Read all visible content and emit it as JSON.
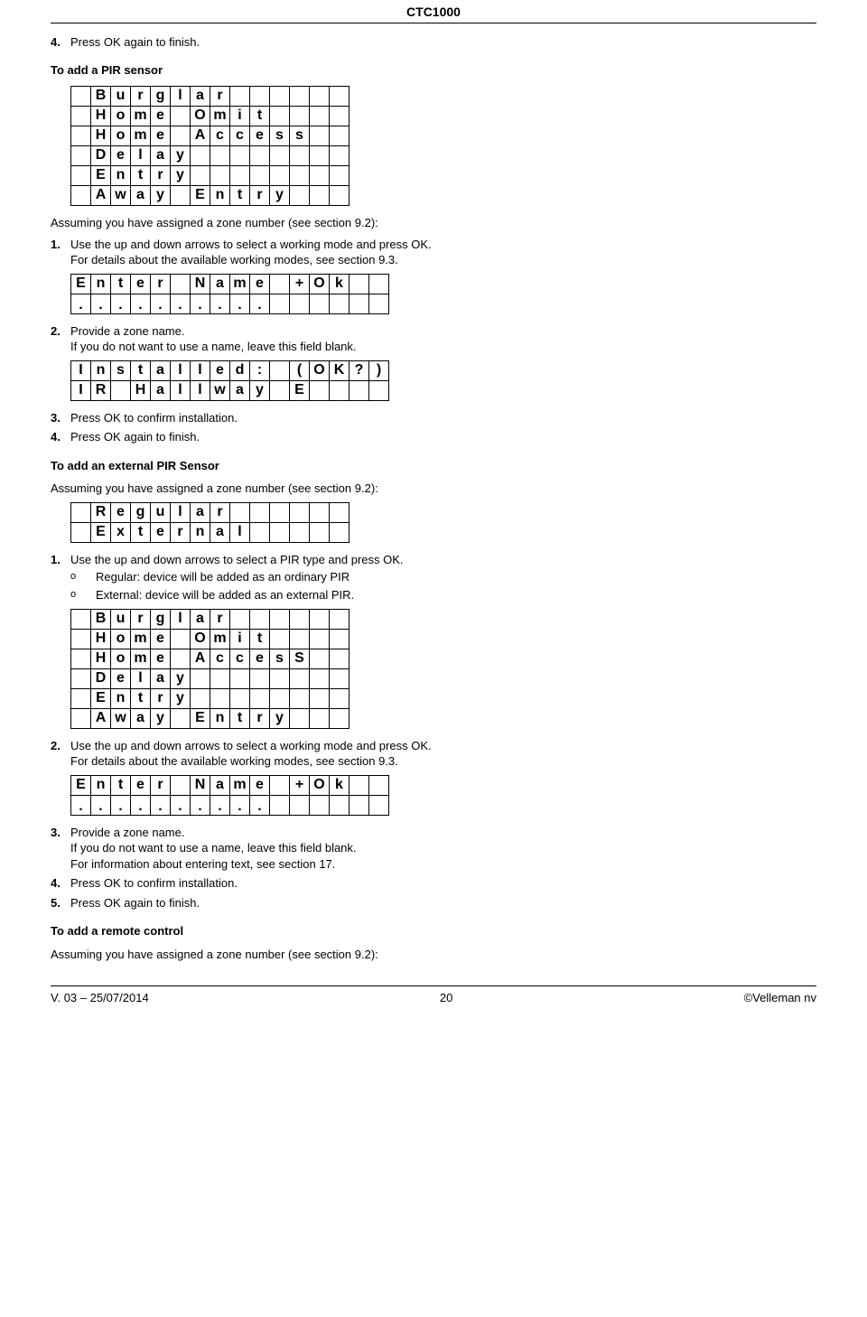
{
  "header": {
    "title": "CTC1000"
  },
  "step4_top": {
    "num": "4.",
    "text": "Press OK again to finish."
  },
  "sec_pir": {
    "heading": "To add a PIR sensor"
  },
  "lcd_pir_modes": [
    [
      "",
      "B",
      "u",
      "r",
      "g",
      "l",
      "a",
      "r",
      "",
      "",
      "",
      "",
      "",
      ""
    ],
    [
      "",
      "H",
      "o",
      "m",
      "e",
      "",
      "O",
      "m",
      "i",
      "t",
      "",
      "",
      "",
      ""
    ],
    [
      "",
      "H",
      "o",
      "m",
      "e",
      "",
      "A",
      "c",
      "c",
      "e",
      "s",
      "s",
      "",
      ""
    ],
    [
      "",
      "D",
      "e",
      "l",
      "a",
      "y",
      "",
      "",
      "",
      "",
      "",
      "",
      "",
      ""
    ],
    [
      "",
      "E",
      "n",
      "t",
      "r",
      "y",
      "",
      "",
      "",
      "",
      "",
      "",
      "",
      ""
    ],
    [
      "",
      "A",
      "w",
      "a",
      "y",
      "",
      "E",
      "n",
      "t",
      "r",
      "y",
      "",
      "",
      ""
    ]
  ],
  "pir_assume": "Assuming you have assigned a zone number (see section 9.2):",
  "pir_s1": {
    "num": "1.",
    "text": "Use the up and down arrows to select a working mode and press OK.",
    "extra": "For details about the available working modes, see section 9.3."
  },
  "lcd_enter_name": [
    [
      "E",
      "n",
      "t",
      "e",
      "r",
      "",
      "N",
      "a",
      "m",
      "e",
      "",
      "+",
      "O",
      "k",
      "",
      ""
    ],
    [
      ".",
      ".",
      ".",
      ".",
      ".",
      ".",
      ".",
      ".",
      ".",
      ".",
      "",
      "",
      "",
      "",
      "",
      ""
    ]
  ],
  "pir_s2": {
    "num": "2.",
    "text": "Provide a zone name.",
    "extra": "If you do not want to use a name, leave this field blank."
  },
  "lcd_installed": [
    [
      "I",
      "n",
      "s",
      "t",
      "a",
      "l",
      "l",
      "e",
      "d",
      ":",
      "",
      "(",
      "O",
      "K",
      "?",
      ")"
    ],
    [
      "I",
      "R",
      "",
      "H",
      "a",
      "l",
      "l",
      "w",
      "a",
      "y",
      "",
      "E",
      "",
      "",
      "",
      ""
    ]
  ],
  "pir_s3": {
    "num": "3.",
    "text": "Press OK to confirm installation."
  },
  "pir_s4": {
    "num": "4.",
    "text": "Press OK again to finish."
  },
  "sec_ext": {
    "heading": "To add an external PIR Sensor",
    "assume": "Assuming you have assigned a zone number (see section 9.2):"
  },
  "lcd_ext_type": [
    [
      "",
      "R",
      "e",
      "g",
      "u",
      "l",
      "a",
      "r",
      "",
      "",
      "",
      "",
      "",
      ""
    ],
    [
      "",
      "E",
      "x",
      "t",
      "e",
      "r",
      "n",
      "a",
      "l",
      "",
      "",
      "",
      "",
      ""
    ]
  ],
  "ext_s1": {
    "num": "1.",
    "text": "Use the up and down arrows to select a PIR type and press OK.",
    "sub1": "Regular: device will be added as an ordinary PIR",
    "sub2": "External: device will be added as an external PIR."
  },
  "lcd_ext_modes": [
    [
      "",
      "B",
      "u",
      "r",
      "g",
      "l",
      "a",
      "r",
      "",
      "",
      "",
      "",
      "",
      ""
    ],
    [
      "",
      "H",
      "o",
      "m",
      "e",
      "",
      "O",
      "m",
      "i",
      "t",
      "",
      "",
      "",
      ""
    ],
    [
      "",
      "H",
      "o",
      "m",
      "e",
      "",
      "A",
      "c",
      "c",
      "e",
      "s",
      "S",
      "",
      ""
    ],
    [
      "",
      "D",
      "e",
      "l",
      "a",
      "y",
      "",
      "",
      "",
      "",
      "",
      "",
      "",
      ""
    ],
    [
      "",
      "E",
      "n",
      "t",
      "r",
      "y",
      "",
      "",
      "",
      "",
      "",
      "",
      "",
      ""
    ],
    [
      "",
      "A",
      "w",
      "a",
      "y",
      "",
      "E",
      "n",
      "t",
      "r",
      "y",
      "",
      "",
      ""
    ]
  ],
  "ext_s2": {
    "num": "2.",
    "text": "Use the up and down arrows to select a working mode and press OK.",
    "extra": "For details about the available working modes, see section 9.3."
  },
  "lcd_enter_name2": [
    [
      "E",
      "n",
      "t",
      "e",
      "r",
      "",
      "N",
      "a",
      "m",
      "e",
      "",
      "+",
      "O",
      "k",
      "",
      ""
    ],
    [
      ".",
      ".",
      ".",
      ".",
      ".",
      ".",
      ".",
      ".",
      ".",
      ".",
      "",
      "",
      "",
      "",
      "",
      ""
    ]
  ],
  "ext_s3": {
    "num": "3.",
    "text": "Provide a zone name.",
    "extra1": "If you do not want to use a name, leave this field blank.",
    "extra2": "For information about entering text, see section 17."
  },
  "ext_s4": {
    "num": "4.",
    "text": "Press OK to confirm installation."
  },
  "ext_s5": {
    "num": "5.",
    "text": "Press OK again to finish."
  },
  "sec_remote": {
    "heading": "To add a remote control",
    "assume": "Assuming you have assigned a zone number (see section 9.2):"
  },
  "footer": {
    "left": "V. 03 – 25/07/2014",
    "center": "20",
    "right": "©Velleman nv"
  }
}
